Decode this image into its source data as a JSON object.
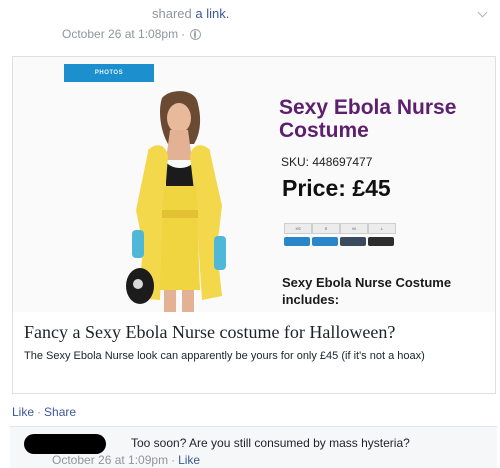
{
  "post": {
    "shared_prefix": "shared ",
    "shared_link": "a link.",
    "timestamp": "October 26 at 1:08pm",
    "meta_sep": "·"
  },
  "preview": {
    "photos_tab": "PHOTOS",
    "product_title": "Sexy Ebola Nurse Costume",
    "sku": "SKU: 448697477",
    "price": "Price: £45",
    "size_options": [
      "XS",
      "S",
      "M",
      "L",
      "XL"
    ],
    "includes": "Sexy Ebola Nurse Costume includes:",
    "accent_color": "#5e1f6f"
  },
  "card": {
    "title": "Fancy a Sexy Ebola Nurse costume for Halloween?",
    "description": "The Sexy Ebola Nurse look can apparently be yours for only £45 (if it's not a hoax)"
  },
  "actions": {
    "like": "Like",
    "sep": "·",
    "share": "Share"
  },
  "comment": {
    "text": "Too soon? Are you still consumed by mass hysteria?",
    "timestamp": "October 26 at 1:09pm",
    "sep": "·",
    "like": "Like"
  },
  "colors": {
    "link_blue": "#3b5998",
    "meta_gray": "#90949c"
  }
}
